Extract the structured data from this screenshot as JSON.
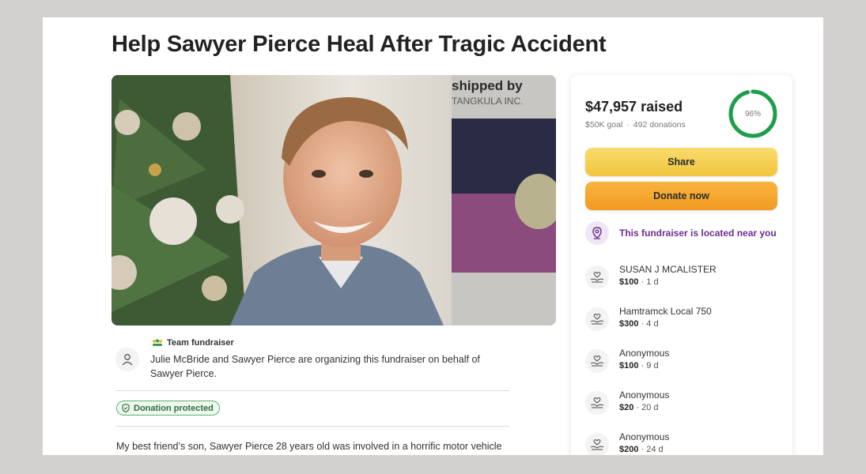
{
  "title": "Help Sawyer Pierce Heal After Tragic Accident",
  "photo": {
    "watermark_line1": "shipped by",
    "watermark_line2": "TANGKULA INC."
  },
  "organizer": {
    "team_label": "Team fundraiser",
    "text": "Julie McBride and Sawyer Pierce are organizing this fundraiser on behalf of Sawyer Pierce."
  },
  "protection_badge": "Donation protected",
  "story_excerpt": "My best friend’s son, Sawyer Pierce 28 years old was involved in a horrific motor vehicle",
  "sidebar": {
    "raised": "$47,957 raised",
    "goal": "$50K goal",
    "donations": "492 donations",
    "progress_label": "96%",
    "progress": 0.96,
    "share_label": "Share",
    "donate_label": "Donate now",
    "location_text": "This fundraiser is located near you",
    "donors": [
      {
        "name": "SUSAN J MCALISTER",
        "amount": "$100",
        "time": "1 d"
      },
      {
        "name": "Hamtramck Local 750",
        "amount": "$300",
        "time": "4 d"
      },
      {
        "name": "Anonymous",
        "amount": "$100",
        "time": "9 d"
      },
      {
        "name": "Anonymous",
        "amount": "$20",
        "time": "20 d"
      },
      {
        "name": "Anonymous",
        "amount": "$200",
        "time": "24 d"
      }
    ]
  },
  "colors": {
    "progress_ring": "#1e9e4a",
    "share_button": "#f4cf4f",
    "donate_button": "#f4a62e",
    "location_text": "#6b2e8f",
    "badge_green": "#5fb370"
  }
}
